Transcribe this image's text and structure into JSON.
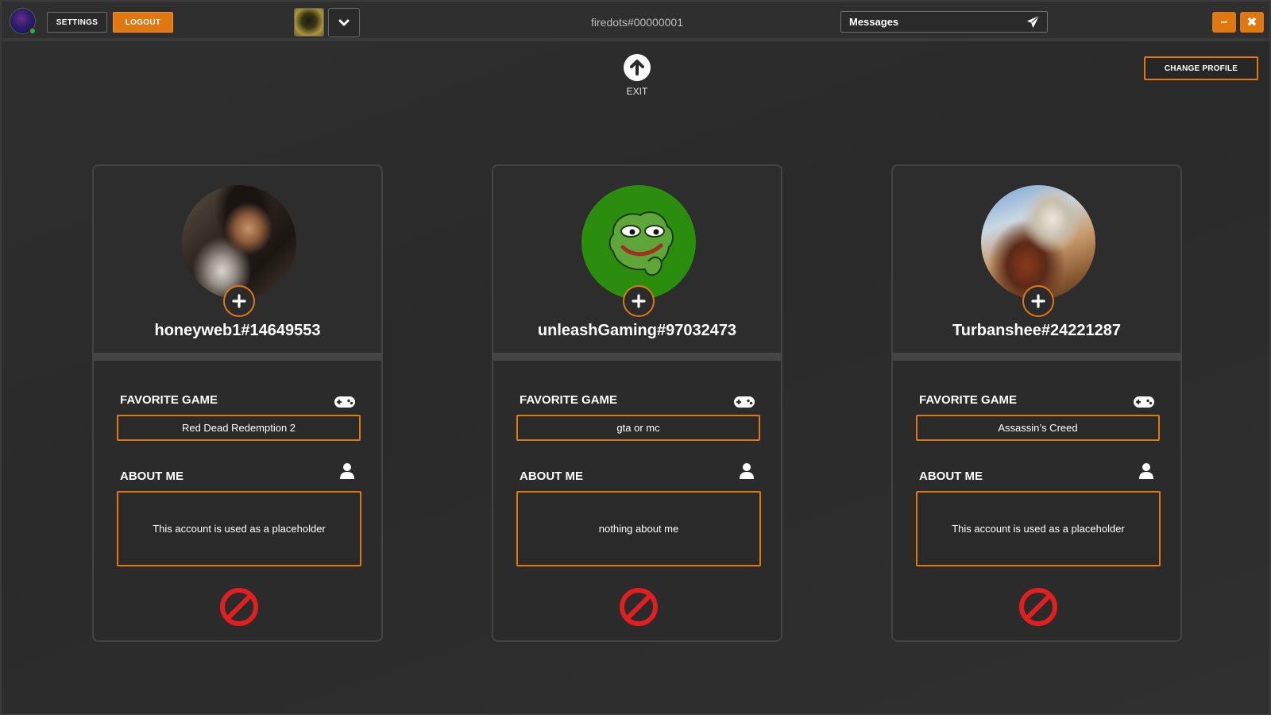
{
  "topbar": {
    "settings_label": "SETTINGS",
    "logout_label": "LOGOUT",
    "title": "firedots#00000001",
    "messages_label": "Messages",
    "minimize_symbol": "–",
    "close_symbol": "✖"
  },
  "header": {
    "exit_label": "EXIT",
    "change_profile_label": "CHANGE PROFILE"
  },
  "cards": [
    {
      "username": "honeyweb1#14649553",
      "favorite_game_title": "FAVORITE GAME",
      "favorite_game": "Red Dead Redemption 2",
      "about_title": "ABOUT ME",
      "about": "This account is used as a placeholder"
    },
    {
      "username": "unleashGaming#97032473",
      "favorite_game_title": "FAVORITE GAME",
      "favorite_game": "gta or mc",
      "about_title": "ABOUT ME",
      "about": "nothing about me"
    },
    {
      "username": "Turbanshee#24221287",
      "favorite_game_title": "FAVORITE GAME",
      "favorite_game": "Assassin’s Creed",
      "about_title": "ABOUT ME",
      "about": "This account is used as a placeholder"
    }
  ],
  "colors": {
    "accent": "#e07812",
    "block": "#e02020",
    "online": "#22b14c",
    "background": "#2b2b2b"
  },
  "icons": {
    "exit": "arrow-up-circle-icon",
    "add": "plus-icon",
    "favorite_game": "gamepad-icon",
    "about": "user-icon",
    "block": "block-icon",
    "messages": "send-icon",
    "dropdown": "chevron-down-icon"
  }
}
